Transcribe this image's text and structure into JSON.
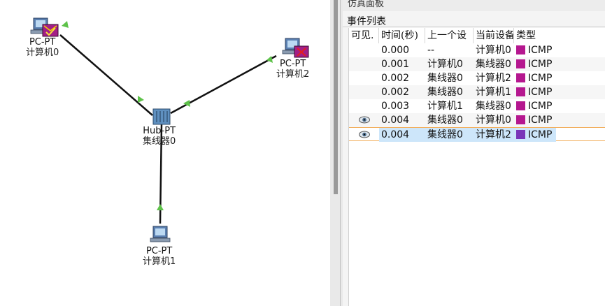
{
  "devices": {
    "pc0": {
      "model": "PC-PT",
      "name": "计算机0"
    },
    "pc2": {
      "model": "PC-PT",
      "name": "计算机2"
    },
    "hub": {
      "model": "Hub-PT",
      "name": "集线器0"
    },
    "pc1": {
      "model": "PC-PT",
      "name": "计算机1"
    }
  },
  "panel": {
    "title": "仿真面板",
    "event_list_label": "事件列表",
    "columns": [
      "可见.",
      "时间(秒)",
      "上一个设",
      "当前设备",
      "类型"
    ],
    "events": [
      {
        "visible": false,
        "time": "0.000",
        "last": "--",
        "current": "计算机0",
        "type": "ICMP",
        "color": "#b5178f"
      },
      {
        "visible": false,
        "time": "0.001",
        "last": "计算机0",
        "current": "集线器0",
        "type": "ICMP",
        "color": "#b5178f"
      },
      {
        "visible": false,
        "time": "0.002",
        "last": "集线器0",
        "current": "计算机2",
        "type": "ICMP",
        "color": "#b5178f"
      },
      {
        "visible": false,
        "time": "0.002",
        "last": "集线器0",
        "current": "计算机1",
        "type": "ICMP",
        "color": "#b5178f"
      },
      {
        "visible": false,
        "time": "0.003",
        "last": "计算机1",
        "current": "集线器0",
        "type": "ICMP",
        "color": "#b5178f"
      },
      {
        "visible": true,
        "time": "0.004",
        "last": "集线器0",
        "current": "计算机0",
        "type": "ICMP",
        "color": "#b5178f"
      },
      {
        "visible": true,
        "time": "0.004",
        "last": "集线器0",
        "current": "计算机2",
        "type": "ICMP",
        "color": "#7a36b8",
        "selected": true
      }
    ]
  },
  "colors": {
    "link": "#111111",
    "link_arrow": "#5ec24a",
    "selection": "#cde6fa"
  }
}
